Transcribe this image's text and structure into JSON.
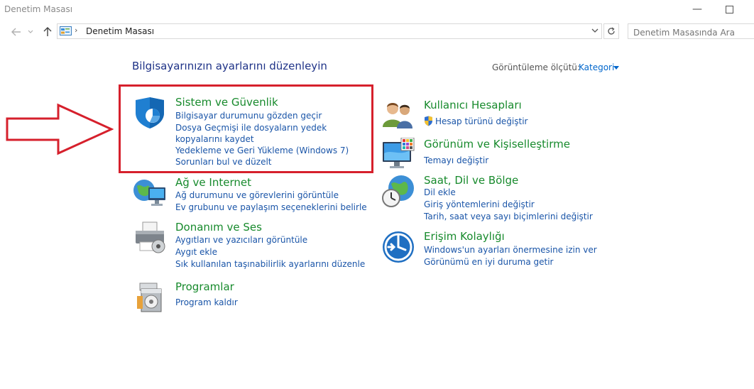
{
  "window": {
    "title": "Denetim Masası"
  },
  "nav": {
    "address_text": "Denetim Masası",
    "search_placeholder": "Denetim Masasında Ara"
  },
  "header": {
    "title": "Bilgisayarınızın ayarlarını düzenleyin",
    "view_label": "Görüntüleme ölçütü:",
    "view_value": "Kategori"
  },
  "colors": {
    "category_title": "#178a2c",
    "link": "#1a55a8",
    "highlight_border": "#d6202c",
    "arrow_outline": "#d6202c"
  },
  "left_categories": [
    {
      "icon": "shield-icon",
      "title": "Sistem ve Güvenlik",
      "links": [
        "Bilgisayar durumunu gözden geçir",
        "Dosya Geçmişi ile dosyaların yedek kopyalarını kaydet",
        "Yedekleme ve Geri Yükleme (Windows 7)",
        "Sorunları bul ve düzelt"
      ]
    },
    {
      "icon": "network-globe-icon",
      "title": "Ağ ve Internet",
      "links": [
        "Ağ durumunu ve görevlerini görüntüle",
        "Ev grubunu ve paylaşım seçeneklerini belirle"
      ]
    },
    {
      "icon": "printer-icon",
      "title": "Donanım ve Ses",
      "links": [
        "Aygıtları ve yazıcıları görüntüle",
        "Aygıt ekle",
        "Sık kullanılan taşınabilirlik ayarlarını düzenle"
      ]
    },
    {
      "icon": "programs-icon",
      "title": "Programlar",
      "links": [
        "Program kaldır"
      ]
    }
  ],
  "right_categories": [
    {
      "icon": "users-icon",
      "title": "Kullanıcı Hesapları",
      "links": [
        "Hesap türünü değiştir"
      ]
    },
    {
      "icon": "monitor-palette-icon",
      "title": "Görünüm ve Kişiselleştirme",
      "links": [
        "Temayı değiştir"
      ]
    },
    {
      "icon": "clock-globe-icon",
      "title": "Saat, Dil ve Bölge",
      "links": [
        "Dil ekle",
        "Giriş yöntemlerini değiştir",
        "Tarih, saat veya sayı biçimlerini değiştir"
      ]
    },
    {
      "icon": "accessibility-icon",
      "title": "Erişim Kolaylığı",
      "links": [
        "Windows'un ayarları önermesine izin ver",
        "Görünümü en iyi duruma getir"
      ]
    }
  ]
}
